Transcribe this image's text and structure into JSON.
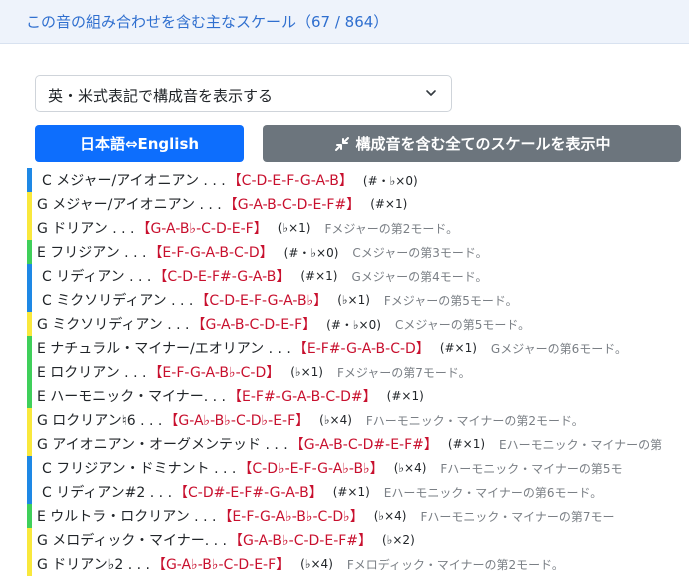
{
  "header": {
    "title": "この音の組み合わせを含む主なスケール（67 / 864）"
  },
  "notation_select": {
    "value": "英・米式表記で構成音を表示する"
  },
  "buttons": {
    "lang_toggle": "日本語⇔English",
    "show_all": "構成音を含む全てのスケールを表示中"
  },
  "colors": {
    "blue": "#1e88e5",
    "yellow": "#f9e83c",
    "green": "#3fcf5a"
  },
  "scales": [
    {
      "bar": "blue",
      "indent": true,
      "name": "C メジャー/アイオニアン . . .",
      "notes": "【C-D-E-F-G-A-B】",
      "acc": "(#・♭×0)",
      "mode": ""
    },
    {
      "bar": "yellow",
      "indent": false,
      "name": "G メジャー/アイオニアン . . .",
      "notes": "【G-A-B-C-D-E-F#】",
      "acc": "(#×1)",
      "mode": ""
    },
    {
      "bar": "yellow",
      "indent": false,
      "name": "G ドリアン . . .",
      "notes": "【G-A-B♭-C-D-E-F】",
      "acc": "(♭×1)",
      "mode": "Fメジャーの第2モード。"
    },
    {
      "bar": "green",
      "indent": false,
      "name": "E フリジアン . . .",
      "notes": "【E-F-G-A-B-C-D】",
      "acc": "(#・♭×0)",
      "mode": "Cメジャーの第3モード。"
    },
    {
      "bar": "blue",
      "indent": true,
      "name": "C リディアン . . .",
      "notes": "【C-D-E-F#-G-A-B】",
      "acc": "(#×1)",
      "mode": "Gメジャーの第4モード。"
    },
    {
      "bar": "blue",
      "indent": true,
      "name": "C ミクソリディアン . . .",
      "notes": "【C-D-E-F-G-A-B♭】",
      "acc": "(♭×1)",
      "mode": "Fメジャーの第5モード。"
    },
    {
      "bar": "yellow",
      "indent": false,
      "name": "G ミクソリディアン . . .",
      "notes": "【G-A-B-C-D-E-F】",
      "acc": "(#・♭×0)",
      "mode": "Cメジャーの第5モード。"
    },
    {
      "bar": "green",
      "indent": false,
      "name": "E ナチュラル・マイナー/エオリアン . . .",
      "notes": "【E-F#-G-A-B-C-D】",
      "acc": "(#×1)",
      "mode": "Gメジャーの第6モード。"
    },
    {
      "bar": "green",
      "indent": false,
      "name": "E ロクリアン . . .",
      "notes": "【E-F-G-A-B♭-C-D】",
      "acc": "(♭×1)",
      "mode": "Fメジャーの第7モード。"
    },
    {
      "bar": "green",
      "indent": false,
      "name": "E ハーモニック・マイナー. . .",
      "notes": "【E-F#-G-A-B-C-D#】",
      "acc": "(#×1)",
      "mode": ""
    },
    {
      "bar": "yellow",
      "indent": false,
      "name": "G ロクリアン♮6 . . .",
      "notes": "【G-A♭-B♭-C-D♭-E-F】",
      "acc": "(♭×4)",
      "mode": "Fハーモニック・マイナーの第2モード。"
    },
    {
      "bar": "yellow",
      "indent": false,
      "name": "G アイオニアン・オーグメンテッド . . .",
      "notes": "【G-A-B-C-D#-E-F#】",
      "acc": "(#×1)",
      "mode": "Eハーモニック・マイナーの第"
    },
    {
      "bar": "blue",
      "indent": true,
      "name": "C フリジアン・ドミナント . . .",
      "notes": "【C-D♭-E-F-G-A♭-B♭】",
      "acc": "(♭×4)",
      "mode": "Fハーモニック・マイナーの第5モ"
    },
    {
      "bar": "blue",
      "indent": true,
      "name": "C リディアン#2 . . .",
      "notes": "【C-D#-E-F#-G-A-B】",
      "acc": "(#×1)",
      "mode": "Eハーモニック・マイナーの第6モード。"
    },
    {
      "bar": "green",
      "indent": false,
      "name": "E ウルトラ・ロクリアン . . .",
      "notes": "【E-F-G-A♭-B♭-C-D♭】",
      "acc": "(♭×4)",
      "mode": "Fハーモニック・マイナーの第7モー"
    },
    {
      "bar": "yellow",
      "indent": false,
      "name": "G メロディック・マイナー. . .",
      "notes": "【G-A-B♭-C-D-E-F#】",
      "acc": "(♭×2)",
      "mode": ""
    },
    {
      "bar": "yellow",
      "indent": false,
      "name": "G ドリアン♭2 . . .",
      "notes": "【G-A♭-B♭-C-D-E-F】",
      "acc": "(♭×4)",
      "mode": "Fメロディック・マイナーの第2モード。"
    }
  ]
}
